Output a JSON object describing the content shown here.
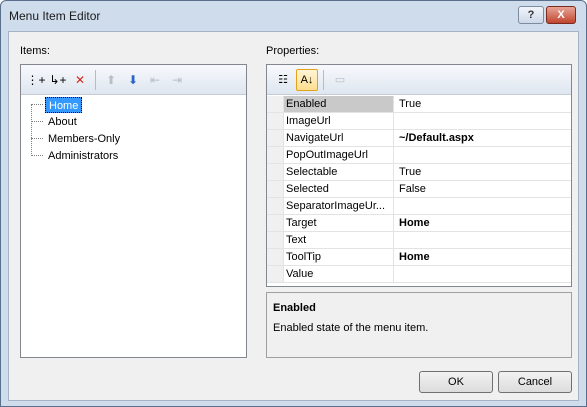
{
  "window": {
    "title": "Menu Item Editor",
    "help_label": "?",
    "close_label": "X"
  },
  "items_panel": {
    "label": "Items:",
    "toolbar": [
      {
        "name": "add-root-item-icon",
        "glyph": "⋮+",
        "disabled": false
      },
      {
        "name": "add-child-item-icon",
        "glyph": "↳+",
        "disabled": false
      },
      {
        "name": "remove-item-icon",
        "glyph": "✕",
        "disabled": false,
        "color": "#d9261c"
      },
      {
        "name": "move-up-icon",
        "glyph": "⬆",
        "disabled": true
      },
      {
        "name": "move-down-icon",
        "glyph": "⬇",
        "disabled": false,
        "color": "#2a63c9"
      },
      {
        "name": "outdent-icon",
        "glyph": "⇤",
        "disabled": true
      },
      {
        "name": "indent-icon",
        "glyph": "⇥",
        "disabled": true
      }
    ],
    "tree": [
      {
        "label": "Home",
        "selected": true
      },
      {
        "label": "About",
        "selected": false
      },
      {
        "label": "Members-Only",
        "selected": false
      },
      {
        "label": "Administrators",
        "selected": false
      }
    ]
  },
  "properties_panel": {
    "label": "Properties:",
    "toolbar": [
      {
        "name": "categorized-icon",
        "glyph": "☷",
        "active": false,
        "disabled": false
      },
      {
        "name": "alphabetical-icon",
        "glyph": "A↓",
        "active": true,
        "disabled": false
      },
      {
        "name": "property-pages-icon",
        "glyph": "▭",
        "active": false,
        "disabled": true
      }
    ],
    "rows": [
      {
        "name": "Enabled",
        "value": "True",
        "bold": false,
        "selected": true
      },
      {
        "name": "ImageUrl",
        "value": "",
        "bold": false,
        "selected": false
      },
      {
        "name": "NavigateUrl",
        "value": "~/Default.aspx",
        "bold": true,
        "selected": false
      },
      {
        "name": "PopOutImageUrl",
        "value": "",
        "bold": false,
        "selected": false
      },
      {
        "name": "Selectable",
        "value": "True",
        "bold": false,
        "selected": false
      },
      {
        "name": "Selected",
        "value": "False",
        "bold": false,
        "selected": false
      },
      {
        "name": "SeparatorImageUr...",
        "value": "",
        "bold": false,
        "selected": false
      },
      {
        "name": "Target",
        "value": "Home",
        "bold": true,
        "selected": false
      },
      {
        "name": "Text",
        "value": "",
        "bold": false,
        "selected": false
      },
      {
        "name": "ToolTip",
        "value": "Home",
        "bold": true,
        "selected": false
      },
      {
        "name": "Value",
        "value": "",
        "bold": false,
        "selected": false
      }
    ]
  },
  "description": {
    "title": "Enabled",
    "text": "Enabled state of the menu item."
  },
  "buttons": {
    "ok": "OK",
    "cancel": "Cancel"
  }
}
